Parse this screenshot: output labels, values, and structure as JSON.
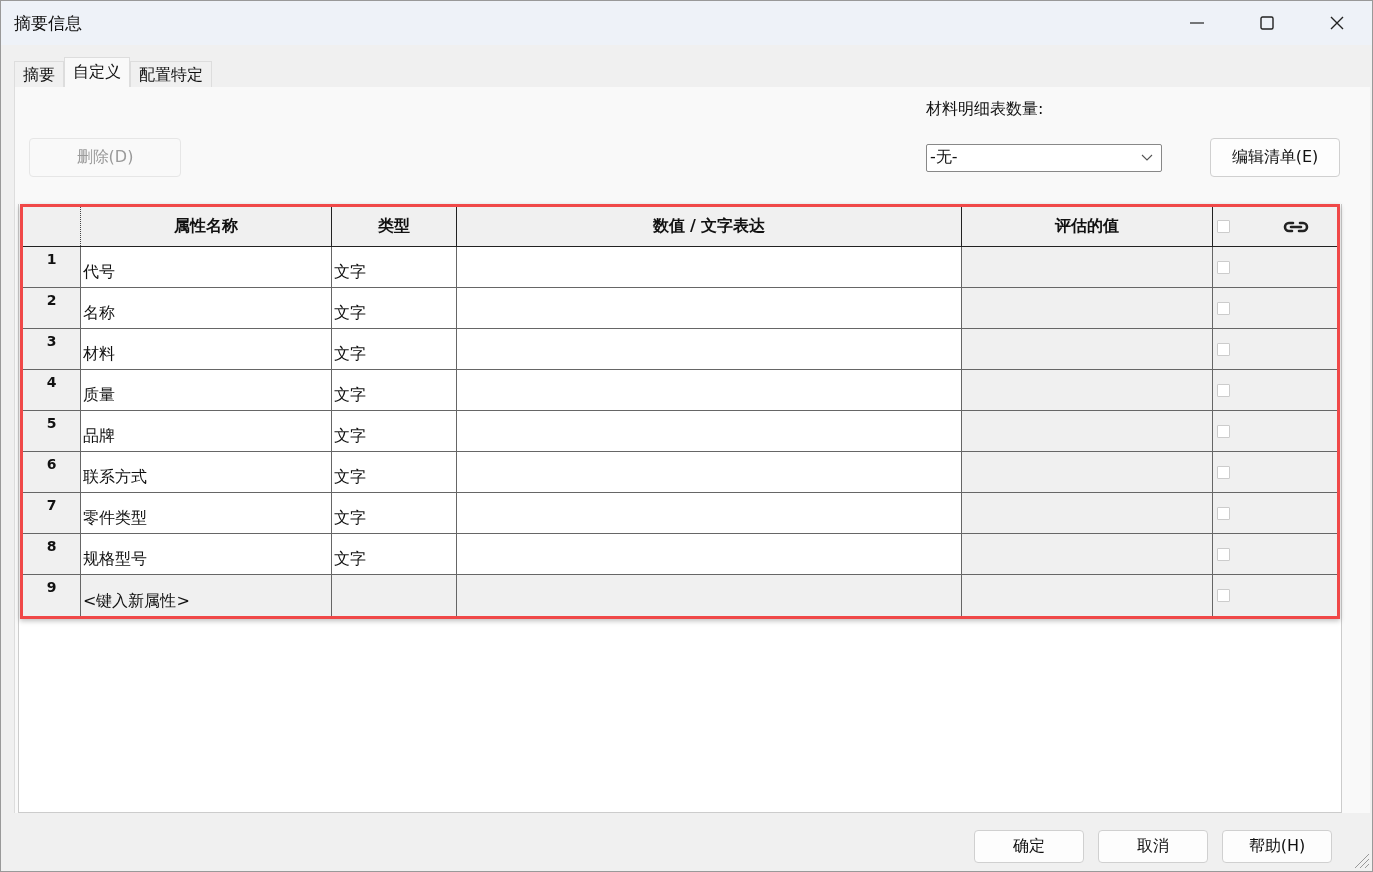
{
  "window": {
    "title": "摘要信息"
  },
  "tabs": [
    {
      "label": "摘要",
      "selected": false
    },
    {
      "label": "自定义",
      "selected": true
    },
    {
      "label": "配置特定",
      "selected": false
    }
  ],
  "delete_button": {
    "label": "删除(D)",
    "disabled": true
  },
  "bom_quantity": {
    "label": "材料明细表数量:",
    "value": "-无-"
  },
  "edit_list_button": {
    "label": "编辑清单(E)"
  },
  "table": {
    "columns": [
      "属性名称",
      "类型",
      "数值 / 文字表达",
      "评估的值"
    ],
    "header_checked": false,
    "rows": [
      {
        "number": "1",
        "name": "代号",
        "type": "文字",
        "kind": "property",
        "checked": false
      },
      {
        "number": "2",
        "name": "名称",
        "type": "文字",
        "kind": "property",
        "checked": false
      },
      {
        "number": "3",
        "name": "材料",
        "type": "文字",
        "kind": "property",
        "checked": false
      },
      {
        "number": "4",
        "name": "质量",
        "type": "文字",
        "kind": "property",
        "checked": false
      },
      {
        "number": "5",
        "name": "品牌",
        "type": "文字",
        "kind": "property",
        "checked": false
      },
      {
        "number": "6",
        "name": "联系方式",
        "type": "文字",
        "kind": "property",
        "checked": false
      },
      {
        "number": "7",
        "name": "零件类型",
        "type": "文字",
        "kind": "property",
        "checked": false
      },
      {
        "number": "8",
        "name": "规格型号",
        "type": "文字",
        "kind": "property",
        "checked": false
      },
      {
        "number": "9",
        "name": "<键入新属性>",
        "kind": "new",
        "checked": false
      }
    ]
  },
  "buttons": [
    "确定",
    "取消",
    "帮助(H)"
  ]
}
